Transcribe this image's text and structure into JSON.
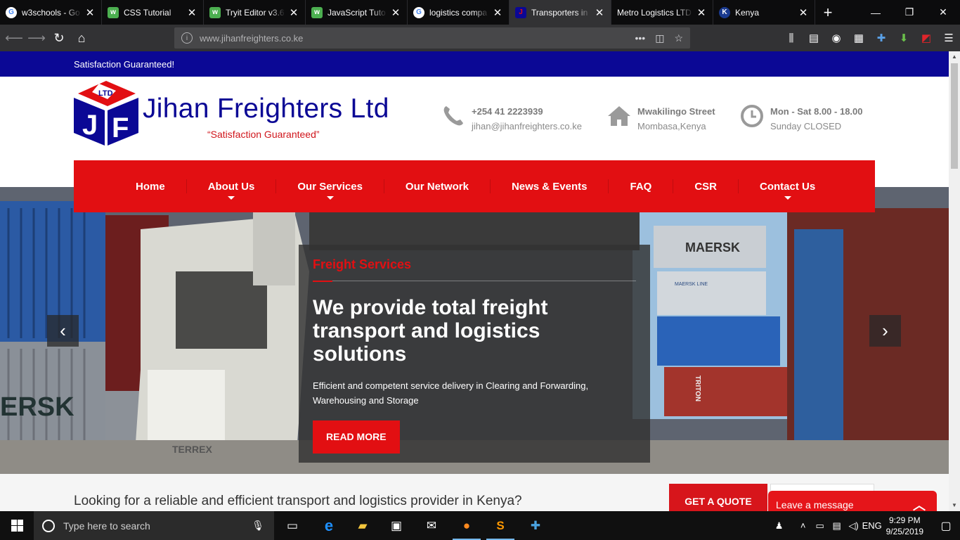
{
  "browser": {
    "tabs": [
      {
        "title": "w3schools - Go",
        "icon": "google-icon",
        "active": false
      },
      {
        "title": "CSS Tutorial",
        "icon": "w3schools-icon",
        "active": false
      },
      {
        "title": "Tryit Editor v3.6",
        "icon": "w3schools-icon",
        "active": false
      },
      {
        "title": "JavaScript Tuto",
        "icon": "w3schools-icon",
        "active": false
      },
      {
        "title": "logistics compa",
        "icon": "google-icon",
        "active": false
      },
      {
        "title": "Transporters in",
        "icon": "jihan-icon",
        "active": true
      },
      {
        "title": "Metro Logistics LTD",
        "icon": "none",
        "active": false
      },
      {
        "title": "Kenya",
        "icon": "kenya-icon",
        "active": false
      }
    ],
    "url": "www.jihanfreighters.co.ke"
  },
  "site": {
    "top_strip": "Satisfaction Guaranteed!",
    "logo_name": "Jihan Freighters Ltd",
    "logo_tagline": "“Satisfaction Guaranteed”",
    "logo_mark_letters": "LTD JF",
    "contacts": [
      {
        "icon": "phone-icon",
        "line1": "+254 41 2223939",
        "line2": "jihan@jihanfreighters.co.ke"
      },
      {
        "icon": "home-icon",
        "line1": "Mwakilingo Street",
        "line2": "Mombasa,Kenya"
      },
      {
        "icon": "clock-icon",
        "line1": "Mon - Sat 8.00 - 18.00",
        "line2": "Sunday CLOSED"
      }
    ],
    "menu": [
      {
        "label": "Home",
        "dropdown": false
      },
      {
        "label": "About Us",
        "dropdown": true
      },
      {
        "label": "Our Services",
        "dropdown": true
      },
      {
        "label": "Our Network",
        "dropdown": false
      },
      {
        "label": "News & Events",
        "dropdown": false
      },
      {
        "label": "FAQ",
        "dropdown": false
      },
      {
        "label": "CSR",
        "dropdown": false
      },
      {
        "label": "Contact Us",
        "dropdown": true
      }
    ],
    "hero": {
      "kicker": "Freight Services",
      "heading": "We provide total freight transport and logistics solutions",
      "text": "Efficient and competent service delivery in Clearing and Forwarding, Warehousing and Storage",
      "button": "READ MORE",
      "container_labels": [
        "MAERSK",
        "MAERSK LINE",
        "ERSK",
        "TERREX",
        "TRITON"
      ]
    },
    "intro_question": "Looking for a reliable and efficient transport and logistics provider in Kenya?",
    "quote_button": "GET A QUOTE",
    "chat_label": "Leave a message"
  },
  "taskbar": {
    "search_placeholder": "Type here to search",
    "time": "9:29 PM",
    "date": "9/25/2019"
  },
  "colors": {
    "brand_blue": "#0b0895",
    "brand_red": "#e20f12",
    "browser_dark": "#0c0c0d"
  }
}
